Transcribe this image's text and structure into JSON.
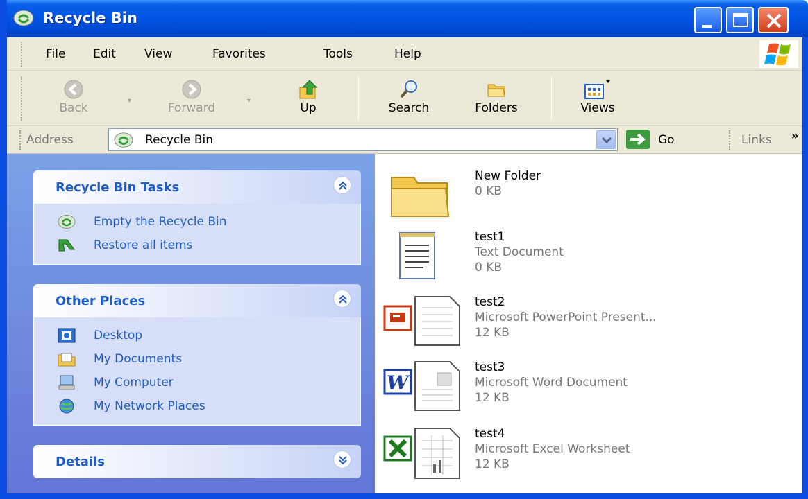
{
  "window": {
    "title": "Recycle Bin"
  },
  "menu": {
    "items": [
      "File",
      "Edit",
      "View",
      "Favorites",
      "Tools",
      "Help"
    ]
  },
  "toolbar": {
    "back": "Back",
    "forward": "Forward",
    "up": "Up",
    "search": "Search",
    "folders": "Folders",
    "views": "Views"
  },
  "address": {
    "label": "Address",
    "value": "Recycle Bin",
    "go": "Go",
    "links": "Links"
  },
  "panels": {
    "tasks": {
      "title": "Recycle Bin Tasks",
      "items": [
        "Empty the Recycle Bin",
        "Restore all items"
      ]
    },
    "places": {
      "title": "Other Places",
      "items": [
        "Desktop",
        "My Documents",
        "My Computer",
        "My Network Places"
      ]
    },
    "details": {
      "title": "Details"
    }
  },
  "files": [
    {
      "name": "New Folder",
      "type": "",
      "size": "0 KB",
      "icon": "folder-icon"
    },
    {
      "name": "test1",
      "type": "Text Document",
      "size": "0 KB",
      "icon": "text-document-icon"
    },
    {
      "name": "test2",
      "type": "Microsoft PowerPoint Present...",
      "size": "12 KB",
      "icon": "powerpoint-icon"
    },
    {
      "name": "test3",
      "type": "Microsoft Word Document",
      "size": "12 KB",
      "icon": "word-icon"
    },
    {
      "name": "test4",
      "type": "Microsoft Excel Worksheet",
      "size": "12 KB",
      "icon": "excel-icon"
    }
  ]
}
